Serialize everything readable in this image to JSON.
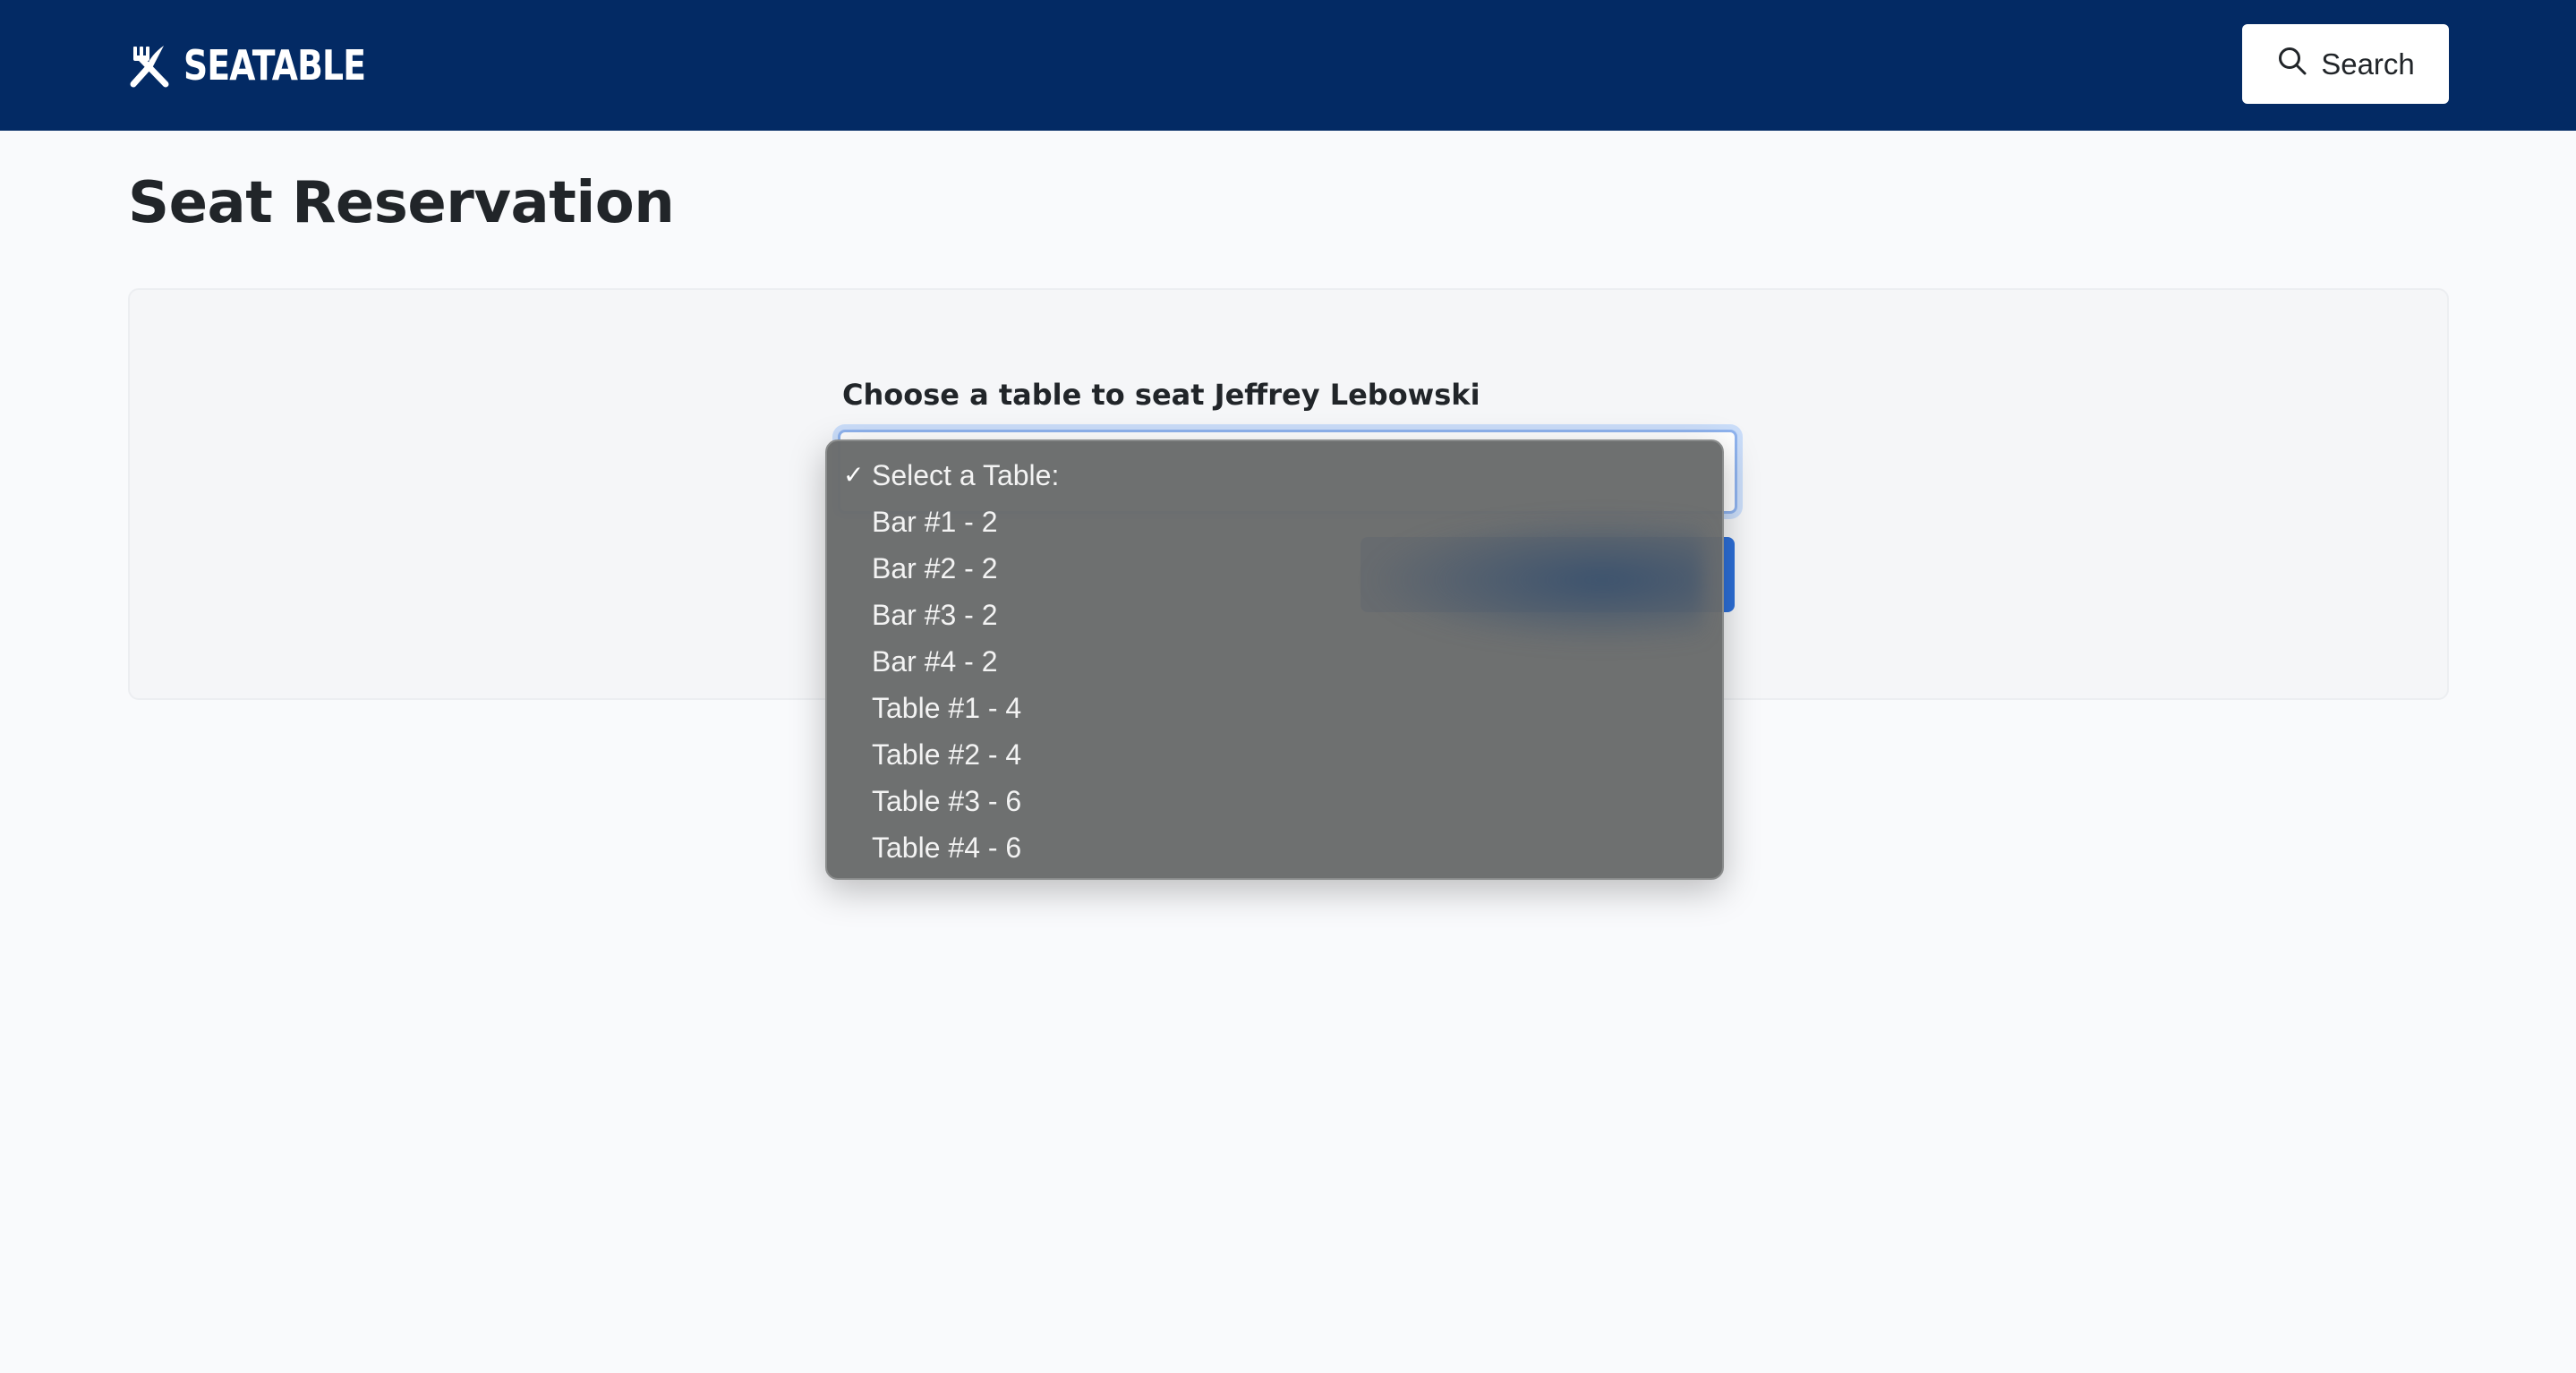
{
  "header": {
    "brand_name": "SEATABLE",
    "brand_icon": "fork-knife-icon",
    "search_label": "Search",
    "search_icon": "search-icon",
    "background_color": "#032a64"
  },
  "page": {
    "title": "Seat Reservation"
  },
  "form": {
    "label": "Choose a table to seat Jeffrey Lebowski",
    "select": {
      "selected_value": "Select a Table:",
      "expanded": true,
      "options": [
        {
          "label": "Select a Table:",
          "selected": true
        },
        {
          "label": "Bar #1 - 2",
          "selected": false
        },
        {
          "label": "Bar #2 - 2",
          "selected": false
        },
        {
          "label": "Bar #3 - 2",
          "selected": false
        },
        {
          "label": "Bar #4 - 2",
          "selected": false
        },
        {
          "label": "Table #1 - 4",
          "selected": false
        },
        {
          "label": "Table #2 - 4",
          "selected": false
        },
        {
          "label": "Table #3 - 6",
          "selected": false
        },
        {
          "label": "Table #4 - 6",
          "selected": false
        }
      ],
      "check_glyph": "✓"
    },
    "submit_color": "#2d6fd8"
  }
}
